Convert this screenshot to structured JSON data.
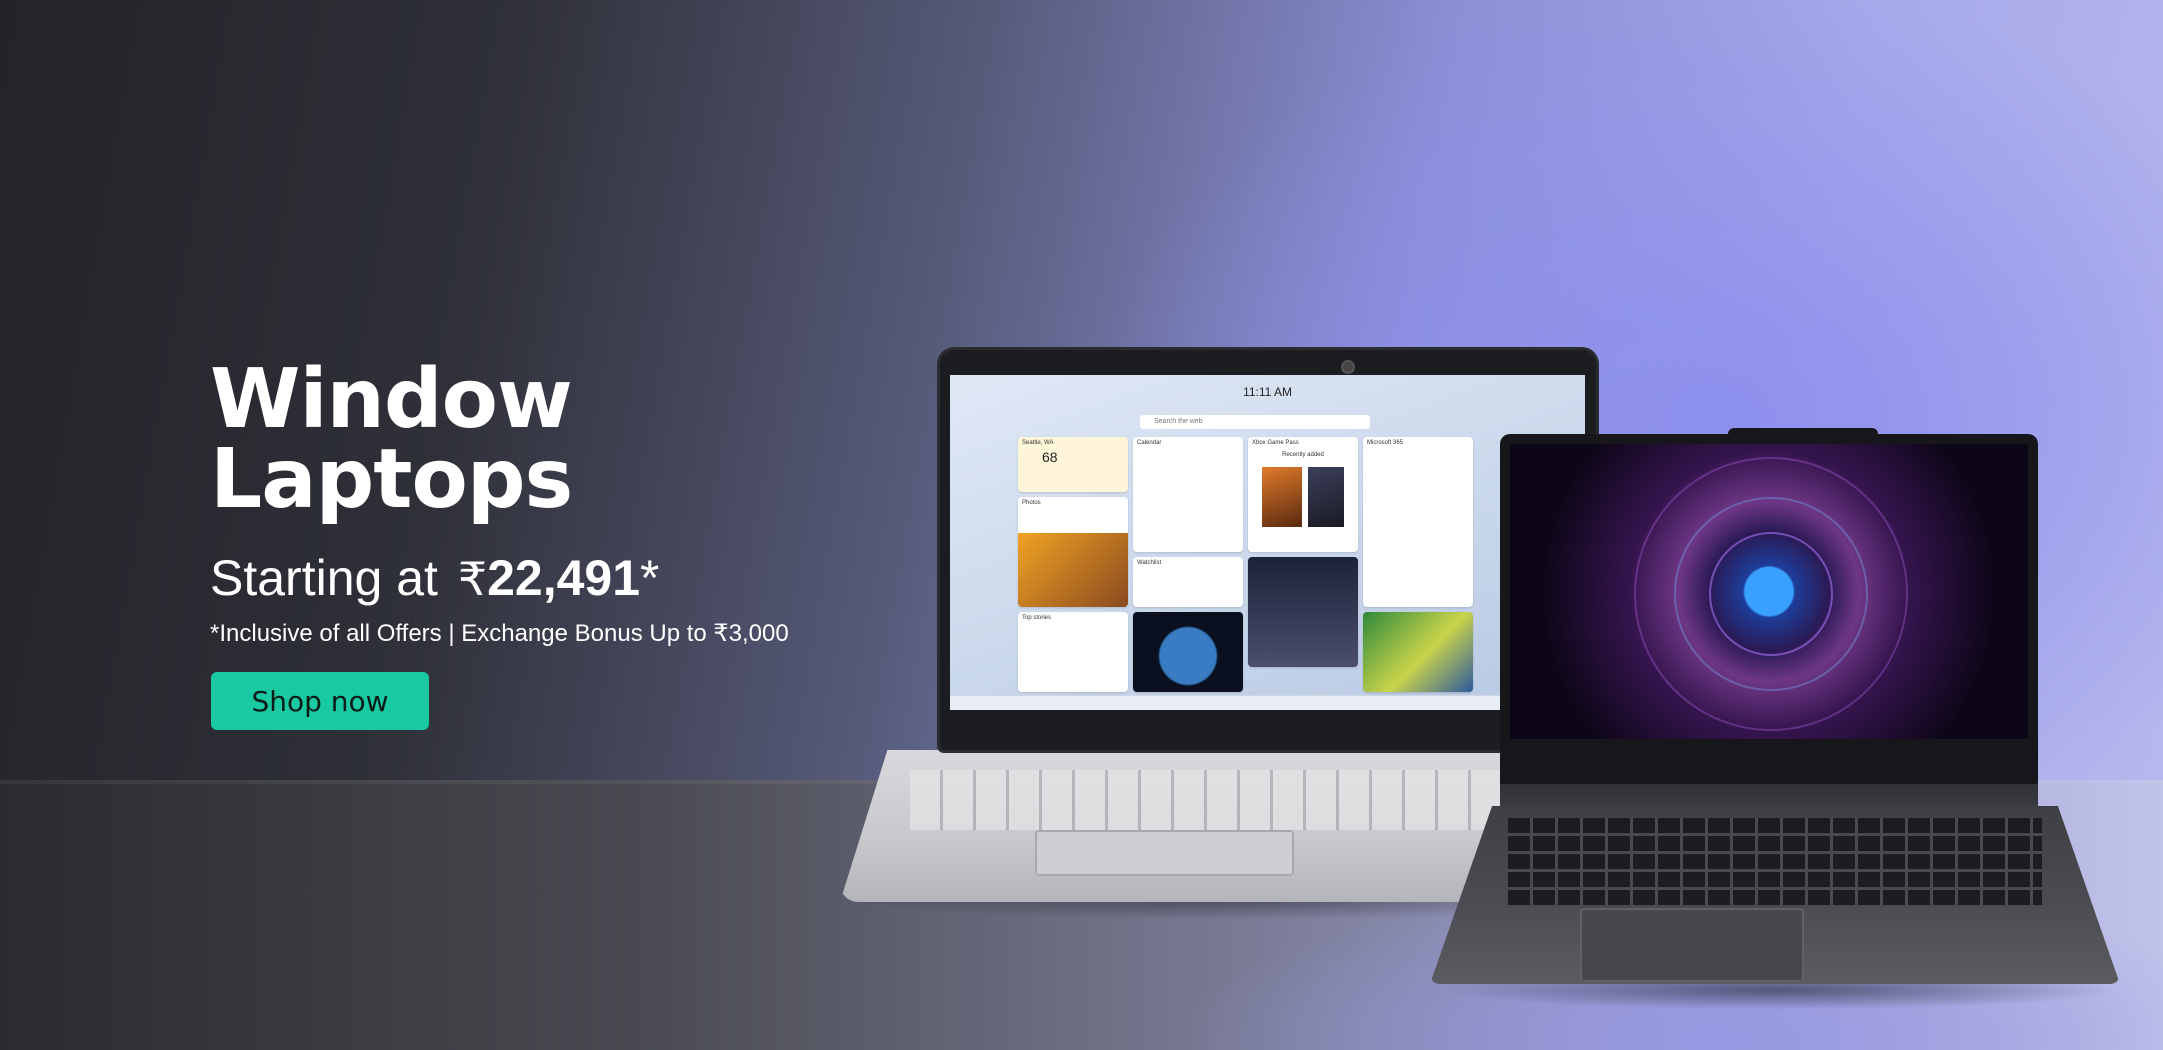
{
  "hero": {
    "headline_line1": "Window",
    "headline_line2": "Laptops",
    "price_prefix": "Starting at",
    "price_currency": "₹",
    "price_amount": "22,491",
    "price_suffix": "*",
    "offer_text": "*Inclusive of all Offers | Exchange Bonus Up to ₹3,000",
    "cta_label": "Shop now"
  },
  "laptop_screen": {
    "clock": "11:11 AM",
    "search_placeholder": "Search the web",
    "widgets": [
      "Seattle, WA",
      "Calendar",
      "Xbox Game Pass",
      "Microsoft 365",
      "Photos",
      "Watchlist",
      "Top stories"
    ],
    "weather_temp": "68",
    "xbox_caption": "Recently added"
  },
  "colors": {
    "cta_background": "#19c9a1",
    "text": "#ffffff"
  },
  "icons": [
    "rupee-symbol",
    "webcam-icon"
  ]
}
